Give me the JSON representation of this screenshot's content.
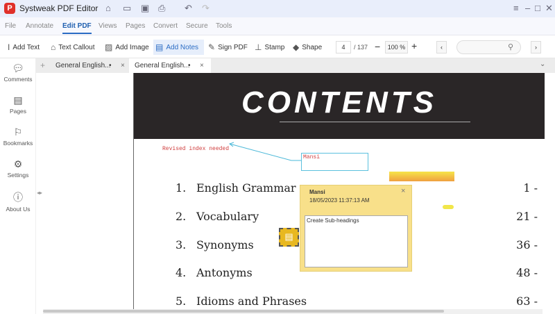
{
  "app": {
    "title": "Systweak PDF Editor",
    "logo": "P"
  },
  "menu": [
    "File",
    "Annotate",
    "Edit PDF",
    "Views",
    "Pages",
    "Convert",
    "Secure",
    "Tools"
  ],
  "toolbar": {
    "add_text": "Add Text",
    "text_callout": "Text Callout",
    "add_image": "Add Image",
    "add_notes": "Add Notes",
    "sign_pdf": "Sign PDF",
    "stamp": "Stamp",
    "shape": "Shape",
    "page": "4",
    "total": "/ 137",
    "zoom": "100 %",
    "search_placeholder": ""
  },
  "sidebar": [
    "Comments",
    "Pages",
    "Bookmarks",
    "Settings",
    "About Us"
  ],
  "tabs": [
    {
      "label": "General English...",
      "dot": "•"
    },
    {
      "label": "General English...",
      "dot": "•"
    }
  ],
  "page": {
    "heading": "CONTENTS",
    "annotation": "Revised index needed",
    "callout_author": "Mansi",
    "items": [
      {
        "n": "1.",
        "t": "English Grammar",
        "p": "1 -"
      },
      {
        "n": "2.",
        "t": "Vocabulary",
        "p": "21 -"
      },
      {
        "n": "3.",
        "t": "Synonyms",
        "p": "36 -"
      },
      {
        "n": "4.",
        "t": "Antonyms",
        "p": "48 -"
      },
      {
        "n": "5.",
        "t": "Idioms and Phrases",
        "p": "63 -"
      }
    ]
  },
  "note": {
    "author": "Mansi",
    "timestamp": "18/05/2023 11:37:13 AM",
    "text": "Create Sub-headings"
  }
}
